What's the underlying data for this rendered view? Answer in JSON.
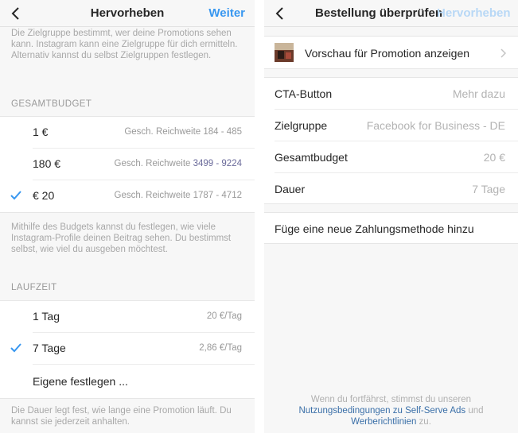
{
  "left": {
    "nav": {
      "title": "Hervorheben",
      "action": "Weiter"
    },
    "audience_info": "Die Zielgruppe bestimmt, wer deine Promotions sehen kann. Instagram kann eine Zielgruppe für dich ermitteln. Alternativ kannst du selbst Zielgruppen festlegen.",
    "budget_header": "GESAMTBUDGET",
    "budget_options": [
      {
        "label": "1 €",
        "reach_prefix": "Gesch. Reichweite",
        "reach": "184 - 485",
        "selected": false
      },
      {
        "label": "180 €",
        "reach_prefix": "Gesch. Reichweite",
        "reach": "3499 - 9224",
        "selected": false
      },
      {
        "label": "€ 20",
        "reach_prefix": "Gesch. Reichweite",
        "reach": "1787 - 4712",
        "selected": true
      }
    ],
    "budget_info": "Mithilfe des Budgets kannst du festlegen, wie viele Instagram-Profile deinen Beitrag sehen. Du bestimmst selbst, wie viel du ausgeben möchtest.",
    "duration_header": "LAUFZEIT",
    "duration_options": [
      {
        "label": "1 Tag",
        "price": "20 €/Tag",
        "selected": false
      },
      {
        "label": "7 Tage",
        "price": "2,86 €/Tag",
        "selected": true
      },
      {
        "label": "Eigene festlegen ...",
        "price": "",
        "selected": false
      }
    ],
    "duration_info": "Die Dauer legt fest, wie lange eine Promotion läuft. Du kannst sie jederzeit anhalten."
  },
  "right": {
    "nav": {
      "title": "Bestellung überprüfen",
      "ghost_title": "Hervorheben"
    },
    "preview_label": "Vorschau für Promotion anzeigen",
    "details": [
      {
        "label": "CTA-Button",
        "value": "Mehr dazu"
      },
      {
        "label": "Zielgruppe",
        "value": "Facebook for Business - DE"
      },
      {
        "label": "Gesamtbudget",
        "value": "20 €"
      },
      {
        "label": "Dauer",
        "value": "7 Tage"
      }
    ],
    "payment_label": "Füge eine neue Zahlungsmethode hinzu",
    "footer": {
      "line1": "Wenn du fortfährst, stimmst du unseren",
      "link1": "Nutzungsbedingungen zu Self-Serve Ads",
      "and": "und",
      "link2": "Werberichtlinien",
      "end": "zu."
    }
  },
  "colors": {
    "accent": "#3897f0",
    "link": "#3a6fa8",
    "bg": "#f7f7f7"
  }
}
